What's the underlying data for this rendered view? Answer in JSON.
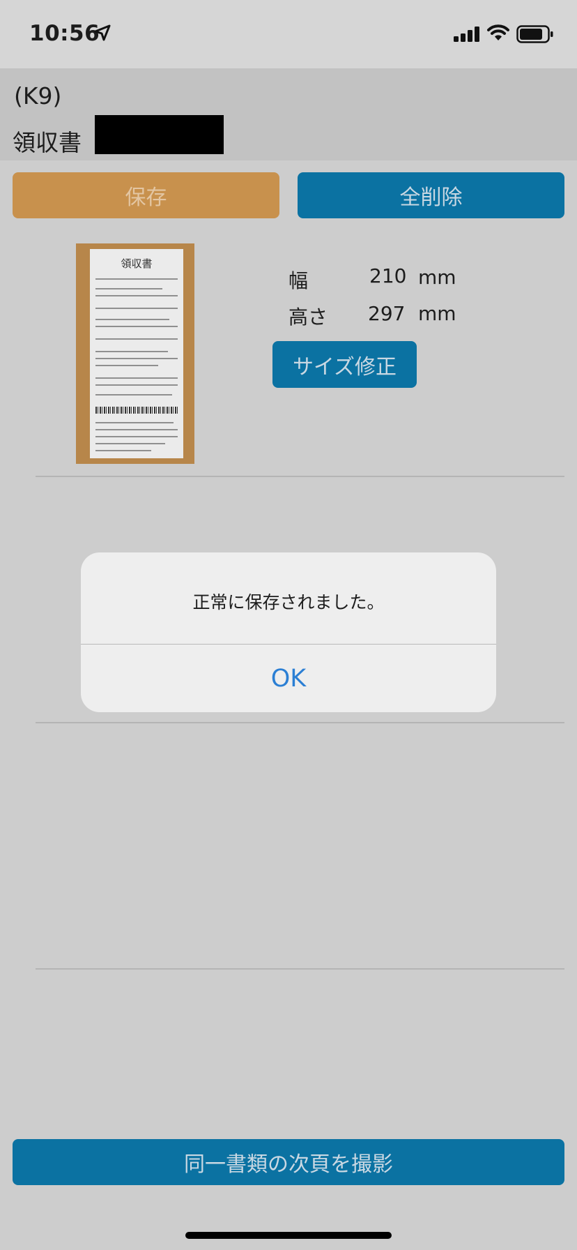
{
  "status_bar": {
    "time": "10:56",
    "icons": [
      "location-arrow-icon",
      "signal-icon",
      "wifi-icon",
      "battery-icon"
    ]
  },
  "header": {
    "code": "(K9)",
    "title": "領収書"
  },
  "toolbar": {
    "save_label": "保存",
    "delete_all_label": "全削除"
  },
  "document": {
    "receipt_title": "領収書",
    "width_label": "幅",
    "width_value": "210",
    "width_unit": "mm",
    "height_label": "高さ",
    "height_value": "297",
    "height_unit": "mm",
    "resize_label": "サイズ修正"
  },
  "dialog": {
    "message": "正常に保存されました。",
    "ok_label": "OK"
  },
  "footer": {
    "next_page_label": "同一書類の次頁を撮影"
  },
  "colors": {
    "accent_blue": "#0b72a2",
    "save_orange": "#c8914d",
    "link_blue": "#2b7fd4"
  }
}
